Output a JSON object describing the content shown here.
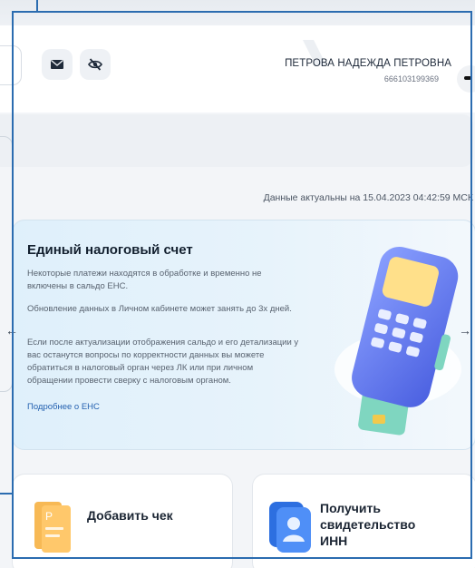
{
  "header": {
    "user_name": "ПЕТРОВА  НАДЕЖДА ПЕТРОВНА",
    "inn": "666103199369",
    "icons": [
      "mail-icon",
      "eye-off-icon"
    ]
  },
  "data_actual": "Данные актуальны на 15.04.2023 04:42:59 МСК",
  "banner": {
    "title": "Единый налоговый счет",
    "text1": "Некоторые платежи находятся в обработке и временно не включены в сальдо ЕНС.",
    "text2": "Обновление данных в Личном кабинете может занять до 3х дней.",
    "text3": "Если после актуализации отображения сальдо и его детализации у вас останутся вопросы по корректности данных вы можете обратиться в налоговый орган через ЛК или при личном обращении провести сверку с налоговым органом.",
    "link": "Подробнее о ЕНС",
    "prev_arrow": "←",
    "next_arrow": "→"
  },
  "cards": [
    {
      "label": "Добавить чек",
      "icon": "receipt-icon"
    },
    {
      "label": "Получить свидетельство ИНН",
      "icon": "id-card-icon"
    }
  ],
  "colors": {
    "accent": "#2b6cb0",
    "link": "#2561b0",
    "banner_bg": "#dff0fb"
  }
}
